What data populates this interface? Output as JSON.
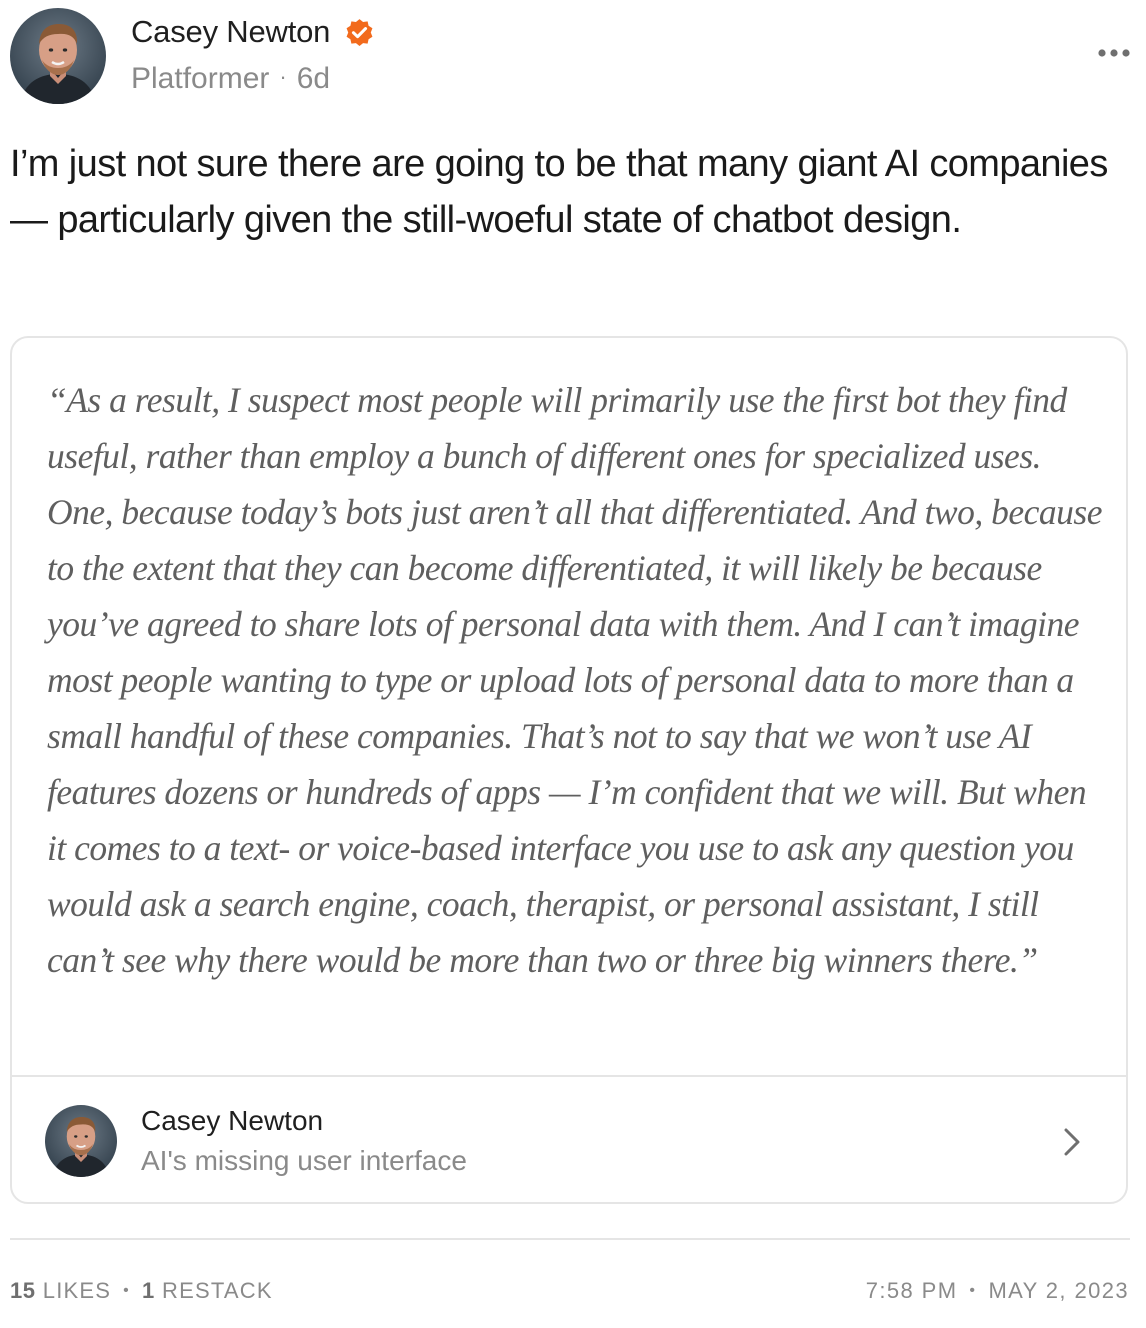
{
  "post": {
    "author_name": "Casey Newton",
    "publication": "Platformer",
    "separator": "·",
    "age": "6d",
    "more_icon": "ellipsis-icon",
    "verified_icon": "verified-badge-icon",
    "body": "I’m just not sure there are going to be that many giant AI companies — particularly given the still-woeful state of chatbot design."
  },
  "quote_card": {
    "text": "“As a result, I suspect most people will primarily use the first bot they find useful, rather than employ a bunch of different ones for specialized uses. One, because today’s bots just aren’t all that differentiated. And two, because to the extent that they can become differentiated, it will likely be because you’ve agreed to share lots of personal data with them. And I can’t imagine most people wanting to type or upload lots of personal data to more than a small handful of these companies. That’s not to say that we won’t use AI features dozens or hundreds of apps — I’m confident that we will. But when it comes to a text- or voice-based interface you use to ask any question you would ask a search engine, coach, therapist, or personal assistant, I still can’t see why there would be more than two or three big winners there.”",
    "source_author": "Casey Newton",
    "source_title": "AI's missing user interface",
    "chevron_icon": "chevron-right-icon"
  },
  "footer": {
    "likes_count": "15",
    "likes_label": "LIKES",
    "restacks_count": "1",
    "restacks_label": "RESTACK",
    "separator": "•",
    "time": "7:58 PM",
    "date": "MAY 2, 2023"
  },
  "colors": {
    "verified_badge": "#f26b1d",
    "secondary_text": "#8a8a8a",
    "border": "#e5e5e5"
  }
}
